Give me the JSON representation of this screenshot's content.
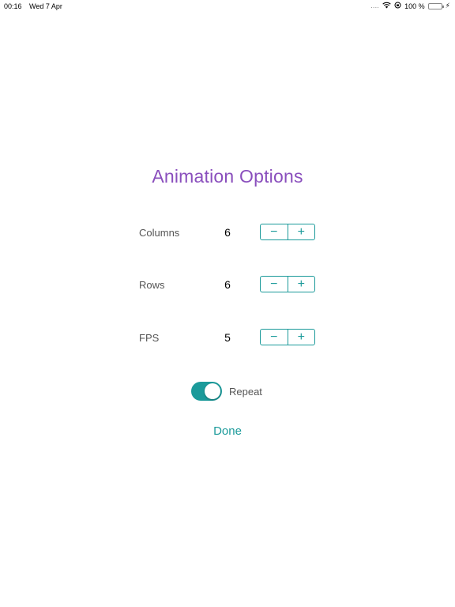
{
  "status_bar": {
    "time": "00:16",
    "date": "Wed 7 Apr",
    "signal": "....",
    "battery_percent": "100 %",
    "icons": [
      "wifi-icon",
      "orientation-lock-icon",
      "battery-icon",
      "charging-icon"
    ]
  },
  "dialog": {
    "title": "Animation Options",
    "options": [
      {
        "label": "Columns",
        "value": "6",
        "decrement": "−",
        "increment": "+"
      },
      {
        "label": "Rows",
        "value": "6",
        "decrement": "−",
        "increment": "+"
      },
      {
        "label": "FPS",
        "value": "5",
        "decrement": "−",
        "increment": "+"
      }
    ],
    "repeat": {
      "label": "Repeat",
      "enabled": true
    },
    "done_label": "Done"
  },
  "colors": {
    "title": "#8a4fbd",
    "accent": "#1b9a9a",
    "label": "#555555"
  }
}
